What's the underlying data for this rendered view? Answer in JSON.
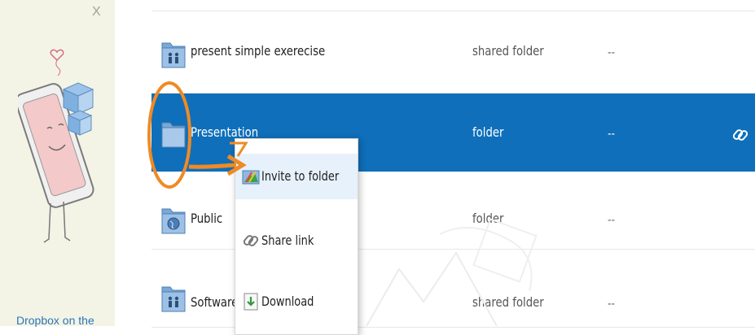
{
  "promo": {
    "close_label": "X",
    "caption": "Dropbox on the"
  },
  "rows": [
    {
      "name": "present simple exerecise",
      "kind": "shared folder",
      "modified": "--",
      "icon": "shared-folder-icon"
    },
    {
      "name": "Presentation",
      "kind": "folder",
      "modified": "--",
      "icon": "folder-icon",
      "selected": true
    },
    {
      "name": "Public",
      "kind": "folder",
      "modified": "--",
      "icon": "public-folder-icon"
    },
    {
      "name": "Software /",
      "kind": "shared folder",
      "modified": "--",
      "icon": "shared-folder-icon"
    }
  ],
  "context_menu": {
    "items": [
      {
        "label": "Invite to folder",
        "icon": "invite-icon"
      },
      {
        "label": "Share link",
        "icon": "link-icon"
      },
      {
        "label": "Download",
        "icon": "download-icon"
      }
    ]
  },
  "colors": {
    "selection": "#0f6fba",
    "annotation": "#f08a24",
    "promo_bg": "#f3f4e6"
  }
}
